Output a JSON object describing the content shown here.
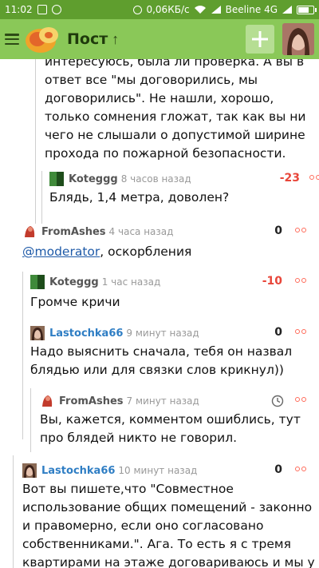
{
  "status": {
    "time": "11:02",
    "network_speed": "0,06КБ/с",
    "carrier": "Beeline 4G",
    "battery_level": 0.75
  },
  "appbar": {
    "title": "Пост",
    "up_arrow": "↑",
    "add": "+"
  },
  "comments": [
    {
      "id": "c0",
      "text": "интересуюсь, была ли проверка. А вы в ответ все \"мы договорились, мы договорились\". Не нашли, хорошо, только сомнения гложат, так как вы ни чего не слышали о допустимой ширине прохода по пожарной безопасности."
    },
    {
      "id": "c1",
      "author": "Koteggg",
      "time": "8 часов назад",
      "rating": "-23",
      "text": "Блядь, 1,4 метра, доволен?"
    },
    {
      "id": "c2",
      "author": "FromAshes",
      "time": "4 часа назад",
      "rating": "0",
      "mention": "@moderator",
      "text": ", оскорбления"
    },
    {
      "id": "c3",
      "author": "Koteggg",
      "time": "1 час назад",
      "rating": "-10",
      "text": "Громче кричи"
    },
    {
      "id": "c4",
      "author": "Lastochka66",
      "time": "9 минут назад",
      "rating": "0",
      "text": "Надо выяснить сначала, тебя он назвал блядью или для связки слов крикнул))"
    },
    {
      "id": "c5",
      "author": "FromAshes",
      "time": "7 минут назад",
      "text": "Вы, кажется, комментом ошиблись, тут про блядей никто не говорил."
    },
    {
      "id": "c6",
      "author": "Lastochka66",
      "time": "10 минут назад",
      "rating": "0",
      "text": "Вот вы пишете,что \"Совместное использование общих помещений - законно и правомерно, если оно согласовано собственниками.\". Ага. То есть я с тремя квартирами на этаже договариваюсь и мы у"
    }
  ]
}
